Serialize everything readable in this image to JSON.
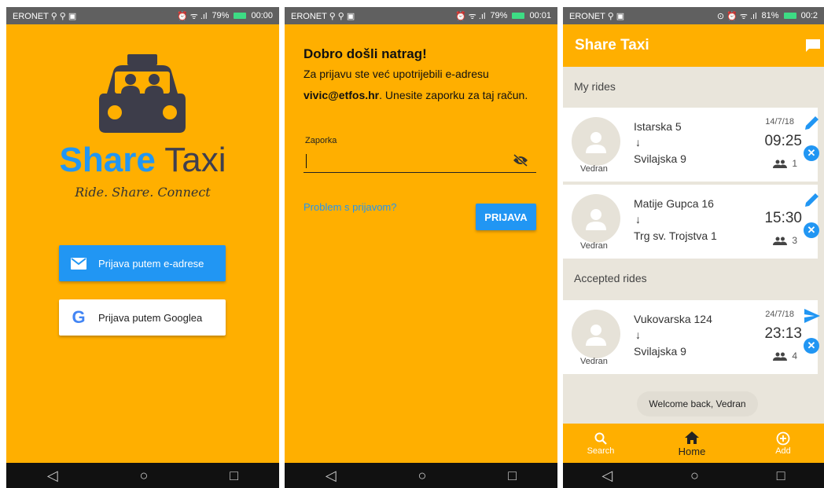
{
  "statusbars": [
    {
      "carrier": "ERONET ⚲ ⚲ ▣",
      "battery": "79%",
      "time": "00:00",
      "signal": "⏰ ᯤ .ıl"
    },
    {
      "carrier": "ERONET ⚲ ⚲ ▣",
      "battery": "79%",
      "time": "00:01",
      "signal": "⏰ ᯤ .ıl"
    },
    {
      "carrier": "ERONET ⚲ ▣",
      "battery": "81%",
      "time": "00:2",
      "signal": "⊙ ⏰ ᯤ .ıl"
    }
  ],
  "nav": {
    "back": "◁",
    "home": "○",
    "recents": "□"
  },
  "login": {
    "brand_part1": "Share",
    "brand_part2": "Taxi",
    "tagline": "Ride. Share. Connect",
    "email_button": "Prijava putem e-adrese",
    "google_button": "Prijava putem Googlea",
    "google_letter": "G"
  },
  "password": {
    "title": "Dobro došli natrag!",
    "text_before": "Za prijavu ste već upotrijebili e-adresu ",
    "email": "vivic@etfos.hr",
    "text_after": ". Unesite zaporku za taj račun.",
    "field_label": "Zaporka",
    "problem_link": "Problem s prijavom?",
    "submit": "PRIJAVA"
  },
  "rides": {
    "app_title": "Share Taxi",
    "my_rides_header": "My rides",
    "accepted_header": "Accepted rides",
    "arrow": "↓",
    "my_rides": [
      {
        "name": "Vedran",
        "from": "Istarska 5",
        "to": "Svilajska 9",
        "date": "14/7/18",
        "time": "09:25",
        "seats": "1"
      },
      {
        "name": "Vedran",
        "from": "Matije Gupca 16",
        "to": "Trg sv. Trojstva 1",
        "date": "",
        "time": "15:30",
        "seats": "3"
      }
    ],
    "accepted_rides": [
      {
        "name": "Vedran",
        "from": "Vukovarska 124",
        "to": "Svilajska 9",
        "date": "24/7/18",
        "time": "23:13",
        "seats": "4"
      }
    ],
    "toast": "Welcome back, Vedran",
    "bottom_nav": {
      "search": "Search",
      "home": "Home",
      "add": "Add"
    }
  },
  "colors": {
    "primary": "#FFAF00",
    "accent": "#2196F3",
    "background": "#E9E5DB"
  }
}
